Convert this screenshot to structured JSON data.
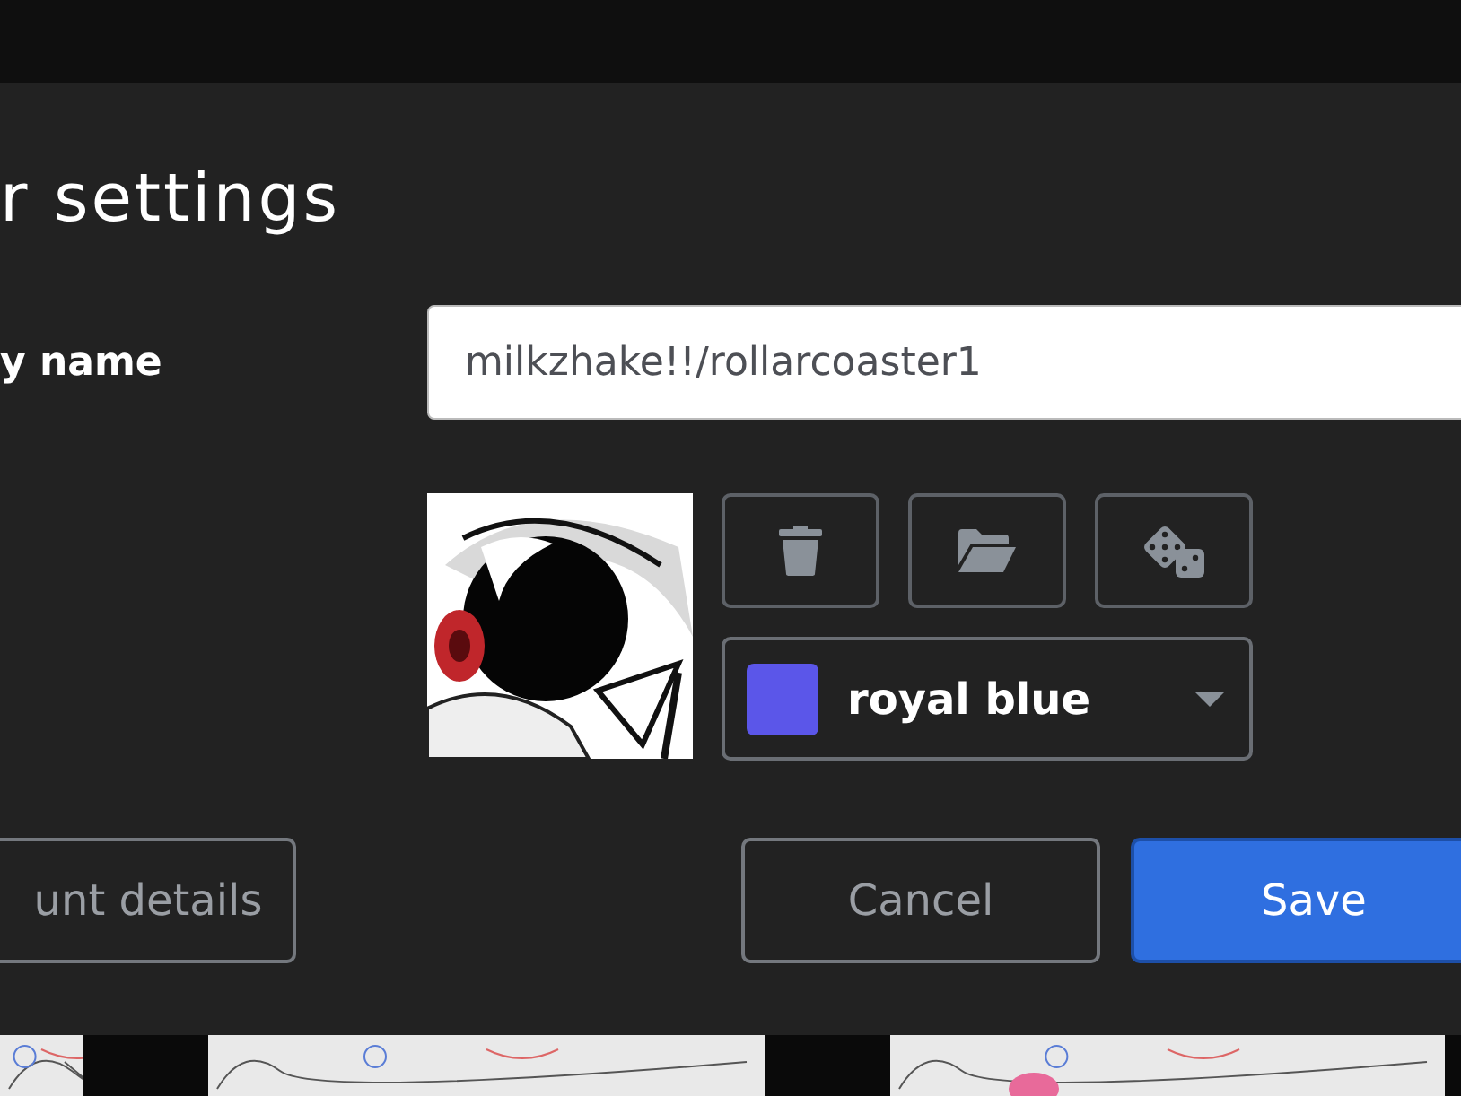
{
  "dialog": {
    "title": "r settings",
    "name_field": {
      "label": "y name",
      "value": "milkzhake!!/rollarcoaster1"
    },
    "avatar_buttons": [
      {
        "kind": "delete"
      },
      {
        "kind": "open"
      },
      {
        "kind": "random"
      }
    ],
    "color_select": {
      "label": "royal blue",
      "color": "#5b56e9"
    },
    "buttons": [
      {
        "label": "unt details",
        "kind": "secondary"
      },
      {
        "label": "Cancel",
        "kind": "secondary"
      },
      {
        "label": "Save",
        "kind": "primary"
      }
    ]
  }
}
